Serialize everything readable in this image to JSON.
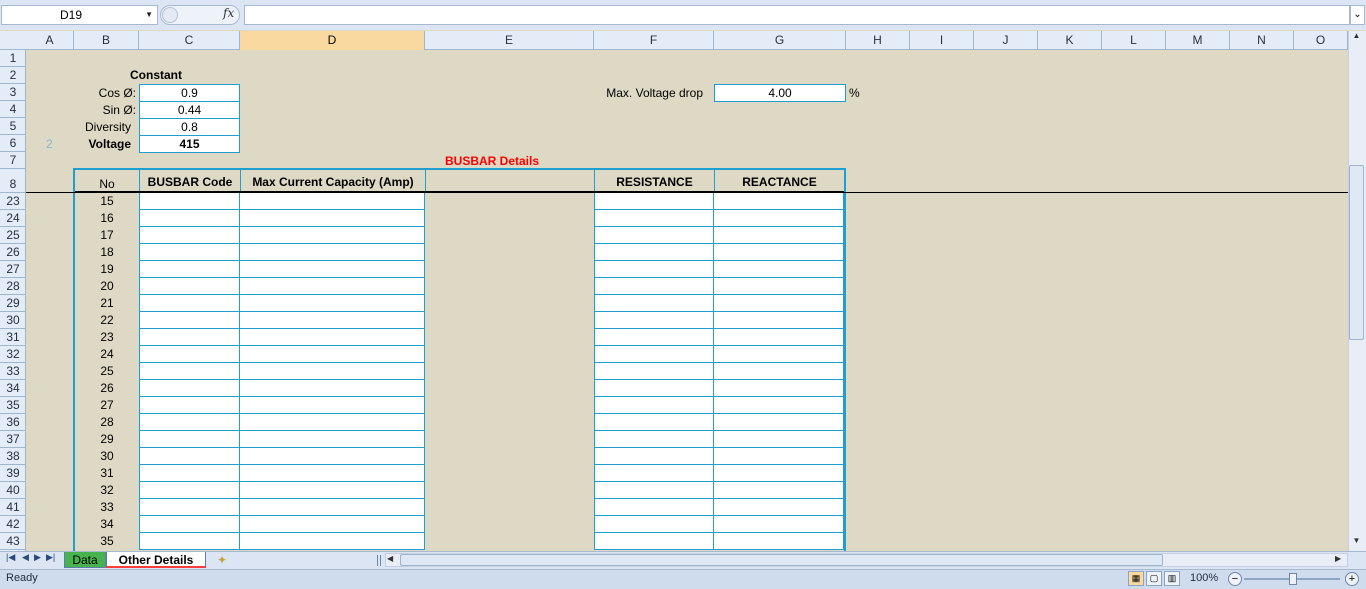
{
  "formula_bar": {
    "name_box": "D19",
    "fx": "fx",
    "formula": ""
  },
  "columns": [
    "A",
    "B",
    "C",
    "D",
    "E",
    "F",
    "G",
    "H",
    "I",
    "J",
    "K",
    "L",
    "M",
    "N",
    "O"
  ],
  "selected_column": "D",
  "row_headers_top": [
    "1",
    "2",
    "3",
    "4",
    "5",
    "6",
    "7",
    "8"
  ],
  "row_headers_body": [
    "23",
    "24",
    "25",
    "26",
    "27",
    "28",
    "29",
    "30",
    "31",
    "32",
    "33",
    "34",
    "35",
    "36",
    "37",
    "38",
    "39",
    "40",
    "41",
    "42",
    "43"
  ],
  "constant": {
    "title": "Constant",
    "cos_label": "Cos Ø:",
    "cos_value": "0.9",
    "sin_label": "Sin Ø:",
    "sin_value": "0.44",
    "diversity_label": "Diversity",
    "diversity_value": "0.8",
    "voltage_label": "Voltage",
    "voltage_value": "415",
    "faded_marker": "2"
  },
  "max_voltage": {
    "label": "Max. Voltage drop",
    "value": "4.00",
    "unit": "%"
  },
  "busbar": {
    "title": "BUSBAR Details",
    "headers": {
      "no": "No",
      "code": "BUSBAR Code",
      "capacity": "Max Current Capacity (Amp)",
      "blank": "",
      "resistance": "RESISTANCE",
      "reactance": "REACTANCE"
    },
    "numbers": [
      "15",
      "16",
      "17",
      "18",
      "19",
      "20",
      "21",
      "22",
      "23",
      "24",
      "25",
      "26",
      "27",
      "28",
      "29",
      "30",
      "31",
      "32",
      "33",
      "34",
      "35"
    ]
  },
  "sheet_tabs": {
    "tab1": "Data",
    "tab2": "Other Details"
  },
  "status": {
    "ready": "Ready",
    "zoom": "100%"
  },
  "colors": {
    "accent_border": "#1e9fd0",
    "sheet_bg": "#ddd9c4",
    "title_red": "#ff0000",
    "tab1_green": "#47b34c"
  }
}
